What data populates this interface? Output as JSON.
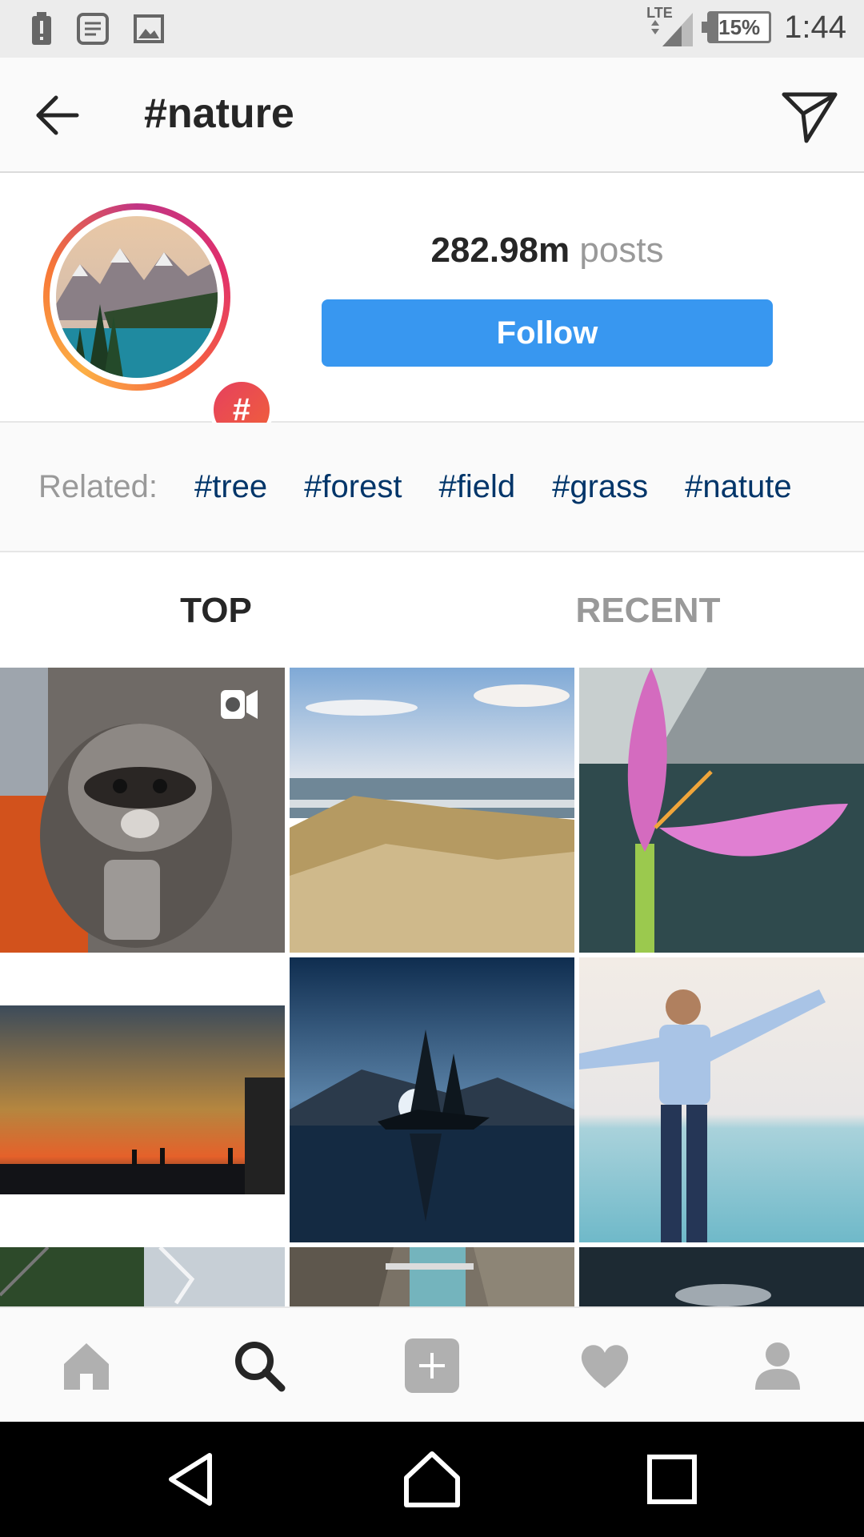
{
  "status_bar": {
    "time": "1:44",
    "battery": "15%",
    "network": "LTE",
    "battery_level": 0.15
  },
  "header": {
    "title": "#nature"
  },
  "profile": {
    "posts_count": "282.98m",
    "posts_label": "posts",
    "follow_label": "Follow",
    "badge": "#"
  },
  "related": {
    "label": "Related:",
    "tags": [
      "#tree",
      "#forest",
      "#field",
      "#grass",
      "#natute"
    ]
  },
  "tabs": [
    {
      "label": "TOP",
      "active": true
    },
    {
      "label": "RECENT",
      "active": false
    }
  ],
  "grid": {
    "posts": [
      {
        "name": "raccoon-photo",
        "is_video": true
      },
      {
        "name": "beach-dunes-photo",
        "is_video": false
      },
      {
        "name": "pink-flower-photo",
        "is_video": false
      },
      {
        "name": "sunset-silhouettes-photo",
        "is_video": false
      },
      {
        "name": "lake-night-photo",
        "is_video": false
      },
      {
        "name": "man-by-pool-photo",
        "is_video": false
      },
      {
        "name": "aerial-forest-photo",
        "is_video": false
      },
      {
        "name": "river-canyon-photo",
        "is_video": false
      },
      {
        "name": "dark-photo",
        "is_video": false
      }
    ]
  },
  "bottom_nav": [
    "home-icon",
    "search-icon",
    "add-post-icon",
    "heart-icon",
    "profile-icon"
  ],
  "colors": {
    "accent": "#3897f0",
    "tag": "#003569",
    "muted": "#999999"
  }
}
